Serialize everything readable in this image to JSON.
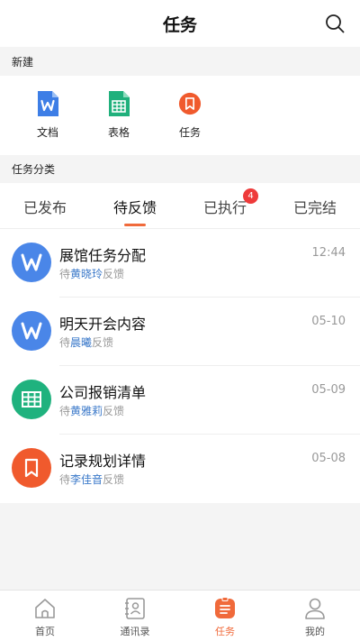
{
  "header": {
    "title": "任务"
  },
  "sections": {
    "new_label": "新建",
    "category_label": "任务分类"
  },
  "new_items": [
    {
      "label": "文档",
      "icon": "word-doc-icon",
      "color": "#3d7ee6"
    },
    {
      "label": "表格",
      "icon": "spreadsheet-icon",
      "color": "#20b07c"
    },
    {
      "label": "任务",
      "icon": "task-icon",
      "color": "#f05a2d"
    }
  ],
  "tabs": [
    {
      "label": "已发布"
    },
    {
      "label": "待反馈",
      "active": true
    },
    {
      "label": "已执行",
      "badge": "4"
    },
    {
      "label": "已完结"
    }
  ],
  "tasks": [
    {
      "title": "展馆任务分配",
      "prefix": "待",
      "name": "黄晓玲",
      "suffix": "反馈",
      "time": "12:44",
      "icon": "word-doc-icon",
      "color": "#4a86e8"
    },
    {
      "title": "明天开会内容",
      "prefix": "待",
      "name": "晨曦",
      "suffix": "反馈",
      "time": "05-10",
      "icon": "word-doc-icon",
      "color": "#4a86e8"
    },
    {
      "title": "公司报销清单",
      "prefix": "待",
      "name": "黄雅莉",
      "suffix": "反馈",
      "time": "05-09",
      "icon": "spreadsheet-icon",
      "color": "#1fb27e"
    },
    {
      "title": "记录规划详情",
      "prefix": "待",
      "name": "李佳音",
      "suffix": "反馈",
      "time": "05-08",
      "icon": "task-icon",
      "color": "#f05a2d"
    }
  ],
  "tabbar": [
    {
      "label": "首页",
      "icon": "home-icon"
    },
    {
      "label": "通讯录",
      "icon": "contacts-icon"
    },
    {
      "label": "任务",
      "icon": "task-icon",
      "active": true
    },
    {
      "label": "我的",
      "icon": "profile-icon"
    }
  ],
  "colors": {
    "accent": "#f06a3b",
    "badge": "#ee3a3a",
    "link": "#3a78c9"
  }
}
